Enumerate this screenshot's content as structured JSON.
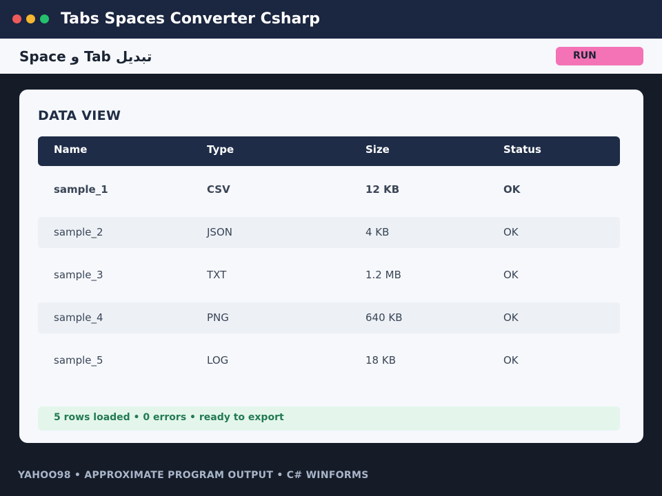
{
  "window": {
    "title": "Tabs Spaces Converter Csharp",
    "controls": [
      "close",
      "minimize",
      "maximize"
    ],
    "control_colors": [
      "#ef5a5a",
      "#f5b731",
      "#25c06d"
    ]
  },
  "header": {
    "heading": "تبديل Tab و Space",
    "run_label": "RUN",
    "accent": "#f472b6"
  },
  "card": {
    "title": "DATA VIEW",
    "columns": [
      "Name",
      "Type",
      "Size",
      "Status"
    ],
    "rows": [
      [
        "sample_1",
        "CSV",
        "12 KB",
        "OK"
      ],
      [
        "sample_2",
        "JSON",
        "4 KB",
        "OK"
      ],
      [
        "sample_3",
        "TXT",
        "1.2 MB",
        "OK"
      ],
      [
        "sample_4",
        "PNG",
        "640 KB",
        "OK"
      ],
      [
        "sample_5",
        "LOG",
        "18 KB",
        "OK"
      ]
    ],
    "status": "5 rows loaded  •  0 errors  •  ready to export"
  },
  "footer": {
    "text": "YAHOO98  •  APPROXIMATE PROGRAM OUTPUT  •  C# WINFORMS"
  }
}
